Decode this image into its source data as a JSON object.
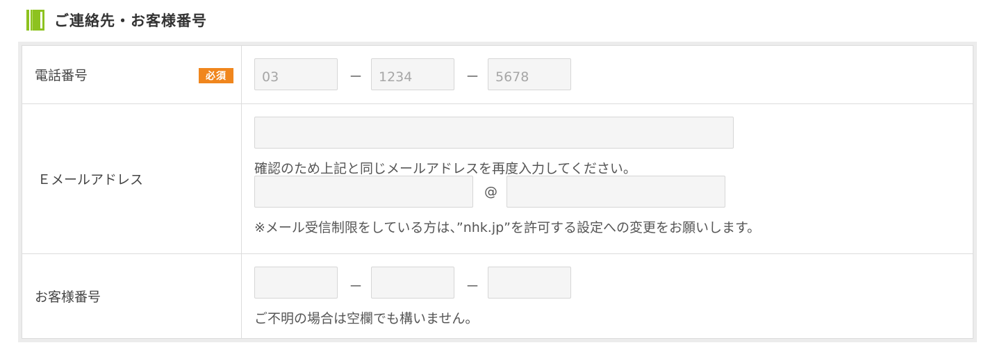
{
  "section": {
    "title": "ご連絡先・お客様番号",
    "icon": "notebook-icon",
    "icon_color": "#8dc21f"
  },
  "phone": {
    "label": "電話番号",
    "required_badge": "必須",
    "badge_color": "#f0861d",
    "part1_placeholder": "03",
    "part2_placeholder": "1234",
    "part3_placeholder": "5678",
    "separator": "－"
  },
  "email": {
    "label": "Ｅメールアドレス",
    "confirm_note": "確認のため上記と同じメールアドレスを再度入力してください。",
    "at_symbol": "@",
    "restriction_note": "※メール受信制限をしている方は、”nhk.jp”を許可する設定への変更をお願いします。"
  },
  "customer": {
    "label": "お客様番号",
    "separator": "－",
    "note": "ご不明の場合は空欄でも構いません。"
  }
}
